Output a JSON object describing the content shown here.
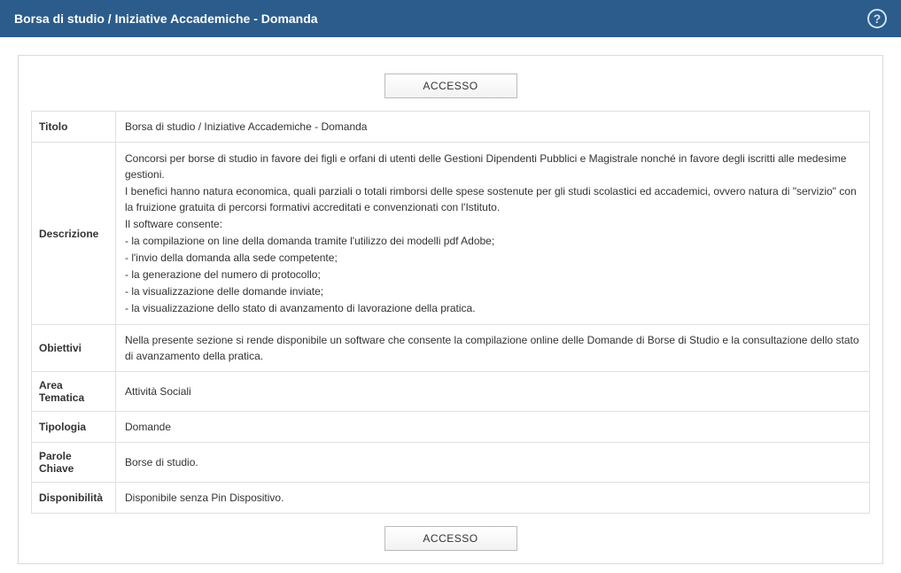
{
  "header": {
    "title": "Borsa di studio / Iniziative Accademiche - Domanda"
  },
  "access_button_label": "ACCESSO",
  "rows": {
    "titolo": {
      "label": "Titolo",
      "value": "Borsa di studio / Iniziative Accademiche - Domanda"
    },
    "descrizione": {
      "label": "Descrizione",
      "p1": "Concorsi per borse di studio in favore dei figli e orfani di utenti delle Gestioni Dipendenti Pubblici e Magistrale nonché in favore degli iscritti alle medesime gestioni.",
      "p2": "I benefici hanno natura economica, quali parziali o totali rimborsi delle spese sostenute per gli studi scolastici ed accademici, ovvero natura di \"servizio\" con la fruizione gratuita di percorsi formativi accreditati e convenzionati con l'Istituto.",
      "p3": "Il software consente:",
      "b1": "- la compilazione on line della domanda tramite l'utilizzo dei modelli pdf Adobe;",
      "b2": "- l'invio della domanda alla sede competente;",
      "b3": "- la generazione del numero di protocollo;",
      "b4": "- la visualizzazione delle domande inviate;",
      "b5": "- la visualizzazione dello stato di avanzamento di lavorazione della pratica."
    },
    "obiettivi": {
      "label": "Obiettivi",
      "value": "Nella presente sezione si rende disponibile un software che consente la compilazione online delle Domande di Borse di Studio e la consultazione dello stato di avanzamento della pratica."
    },
    "area_tematica": {
      "label": "Area Tematica",
      "value": "Attività Sociali"
    },
    "tipologia": {
      "label": "Tipologia",
      "value": "Domande"
    },
    "parole_chiave": {
      "label": "Parole Chiave",
      "value": "Borse di studio."
    },
    "disponibilita": {
      "label": "Disponibilità",
      "value": "Disponibile senza Pin Dispositivo."
    }
  }
}
